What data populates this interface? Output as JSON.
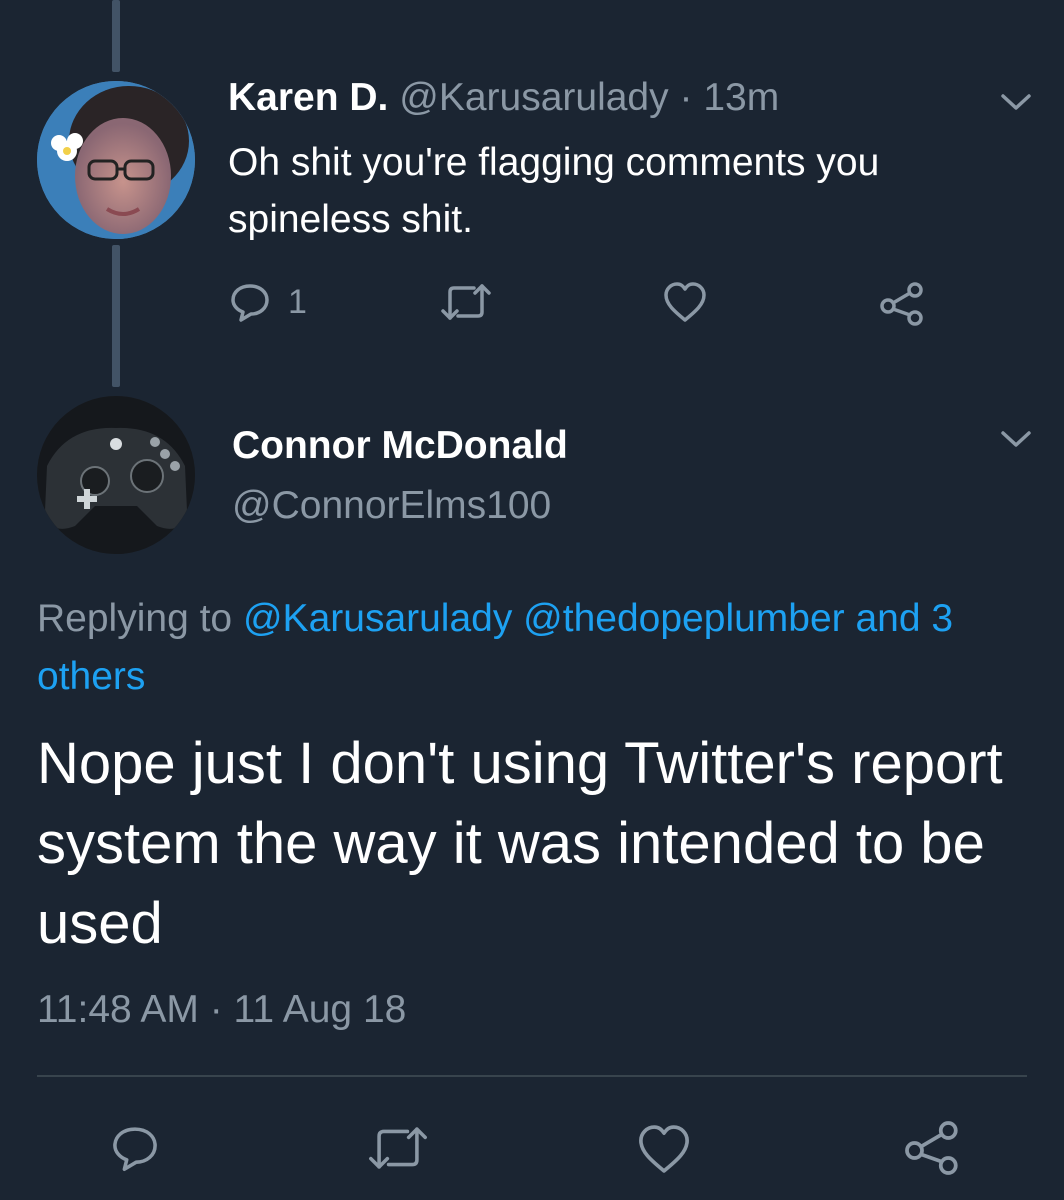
{
  "reply_tweet": {
    "display_name": "Karen D.",
    "handle": "@Karusarulady",
    "separator": "·",
    "time_ago": "13m",
    "text": "Oh shit you're flagging comments you spineless shit.",
    "reply_count": "1",
    "avatar_icon": "user-avatar-photo"
  },
  "main_tweet": {
    "display_name": "Connor McDonald",
    "handle": "@ConnorElms100",
    "replying_prefix": "Replying to",
    "replying_mentions": "@Karusarulady @thedopeplumber and 3 others",
    "text": "Nope just I don't using Twitter's report system the way it was intended to be used",
    "timestamp": "11:48 AM · 11 Aug 18",
    "avatar_icon": "game-controller-avatar-photo"
  },
  "colors": {
    "background": "#1b2532",
    "muted_text": "#8b98a5",
    "link": "#1da1f2",
    "thread_line": "#425366"
  },
  "icons": {
    "reply": "speech-bubble-icon",
    "retweet": "retweet-icon",
    "like": "heart-icon",
    "share": "share-icon",
    "more": "chevron-down-icon"
  }
}
